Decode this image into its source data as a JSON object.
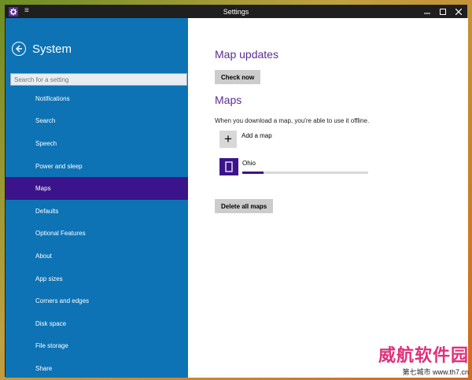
{
  "titlebar": {
    "title": "Settings",
    "app_icon": "gear-icon",
    "menu_icon": "hamburger-icon",
    "buttons": [
      "minimize",
      "maximize",
      "close"
    ]
  },
  "sidebar": {
    "title": "System",
    "search_placeholder": "Search for a setting",
    "items": [
      {
        "label": "Notifications"
      },
      {
        "label": "Search"
      },
      {
        "label": "Speech"
      },
      {
        "label": "Power and sleep"
      },
      {
        "label": "Maps",
        "active": true
      },
      {
        "label": "Defaults"
      },
      {
        "label": "Optional Features"
      },
      {
        "label": "About"
      },
      {
        "label": "App sizes"
      },
      {
        "label": "Corners and edges"
      },
      {
        "label": "Disk space"
      },
      {
        "label": "File storage"
      },
      {
        "label": "Share"
      }
    ]
  },
  "main": {
    "updates_heading": "Map updates",
    "check_now": "Check now",
    "maps_heading": "Maps",
    "description": "When you download a map, you're able to use it offline.",
    "add_map": "Add a map",
    "maps": [
      {
        "name": "Ohio",
        "progress": 0.17
      }
    ],
    "delete_all": "Delete all maps"
  },
  "watermark": {
    "line1": "威航软件园",
    "line2": "第七城市 www.th7.cn"
  },
  "colors": {
    "sidebar_bg": "#0d73b5",
    "accent": "#3b148c",
    "heading": "#5a2d91"
  }
}
